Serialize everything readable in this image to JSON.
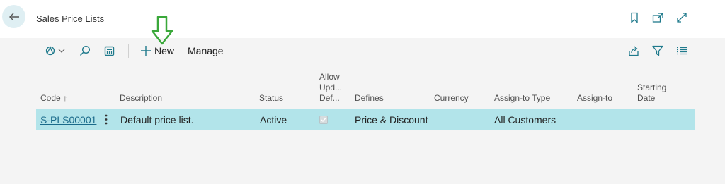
{
  "header": {
    "title": "Sales Price Lists",
    "icons": [
      "back-arrow-icon",
      "bookmark-icon",
      "open-in-new-window-icon",
      "expand-icon"
    ]
  },
  "toolbar": {
    "new_label": "New",
    "manage_label": "Manage",
    "icons": [
      "analysis-icon",
      "search-icon",
      "filter-pane-icon",
      "share-icon",
      "filter-icon",
      "list-view-icon"
    ]
  },
  "annotation": {
    "icon": "down-arrow-icon",
    "color": "#3aa83a"
  },
  "table": {
    "columns": {
      "code": "Code",
      "sort_indicator": "↑",
      "description": "Description",
      "status": "Status",
      "allow_line1": "Allow",
      "allow_line2": "Upd...",
      "allow_line3": "Def...",
      "defines": "Defines",
      "currency": "Currency",
      "assign_type": "Assign-to Type",
      "assign_to": "Assign-to",
      "start_line1": "Starting",
      "start_line2": "Date"
    },
    "rows": [
      {
        "code": "S-PLS00001",
        "description": "Default price list.",
        "status": "Active",
        "allow_updating_defaults": true,
        "defines": "Price & Discount",
        "currency": "",
        "assign_to_type": "All Customers",
        "assign_to": "",
        "starting_date": ""
      }
    ]
  },
  "colors": {
    "selected_row": "#b2e4ea",
    "link": "#1a6a8a",
    "accent": "#1f7a8c"
  }
}
